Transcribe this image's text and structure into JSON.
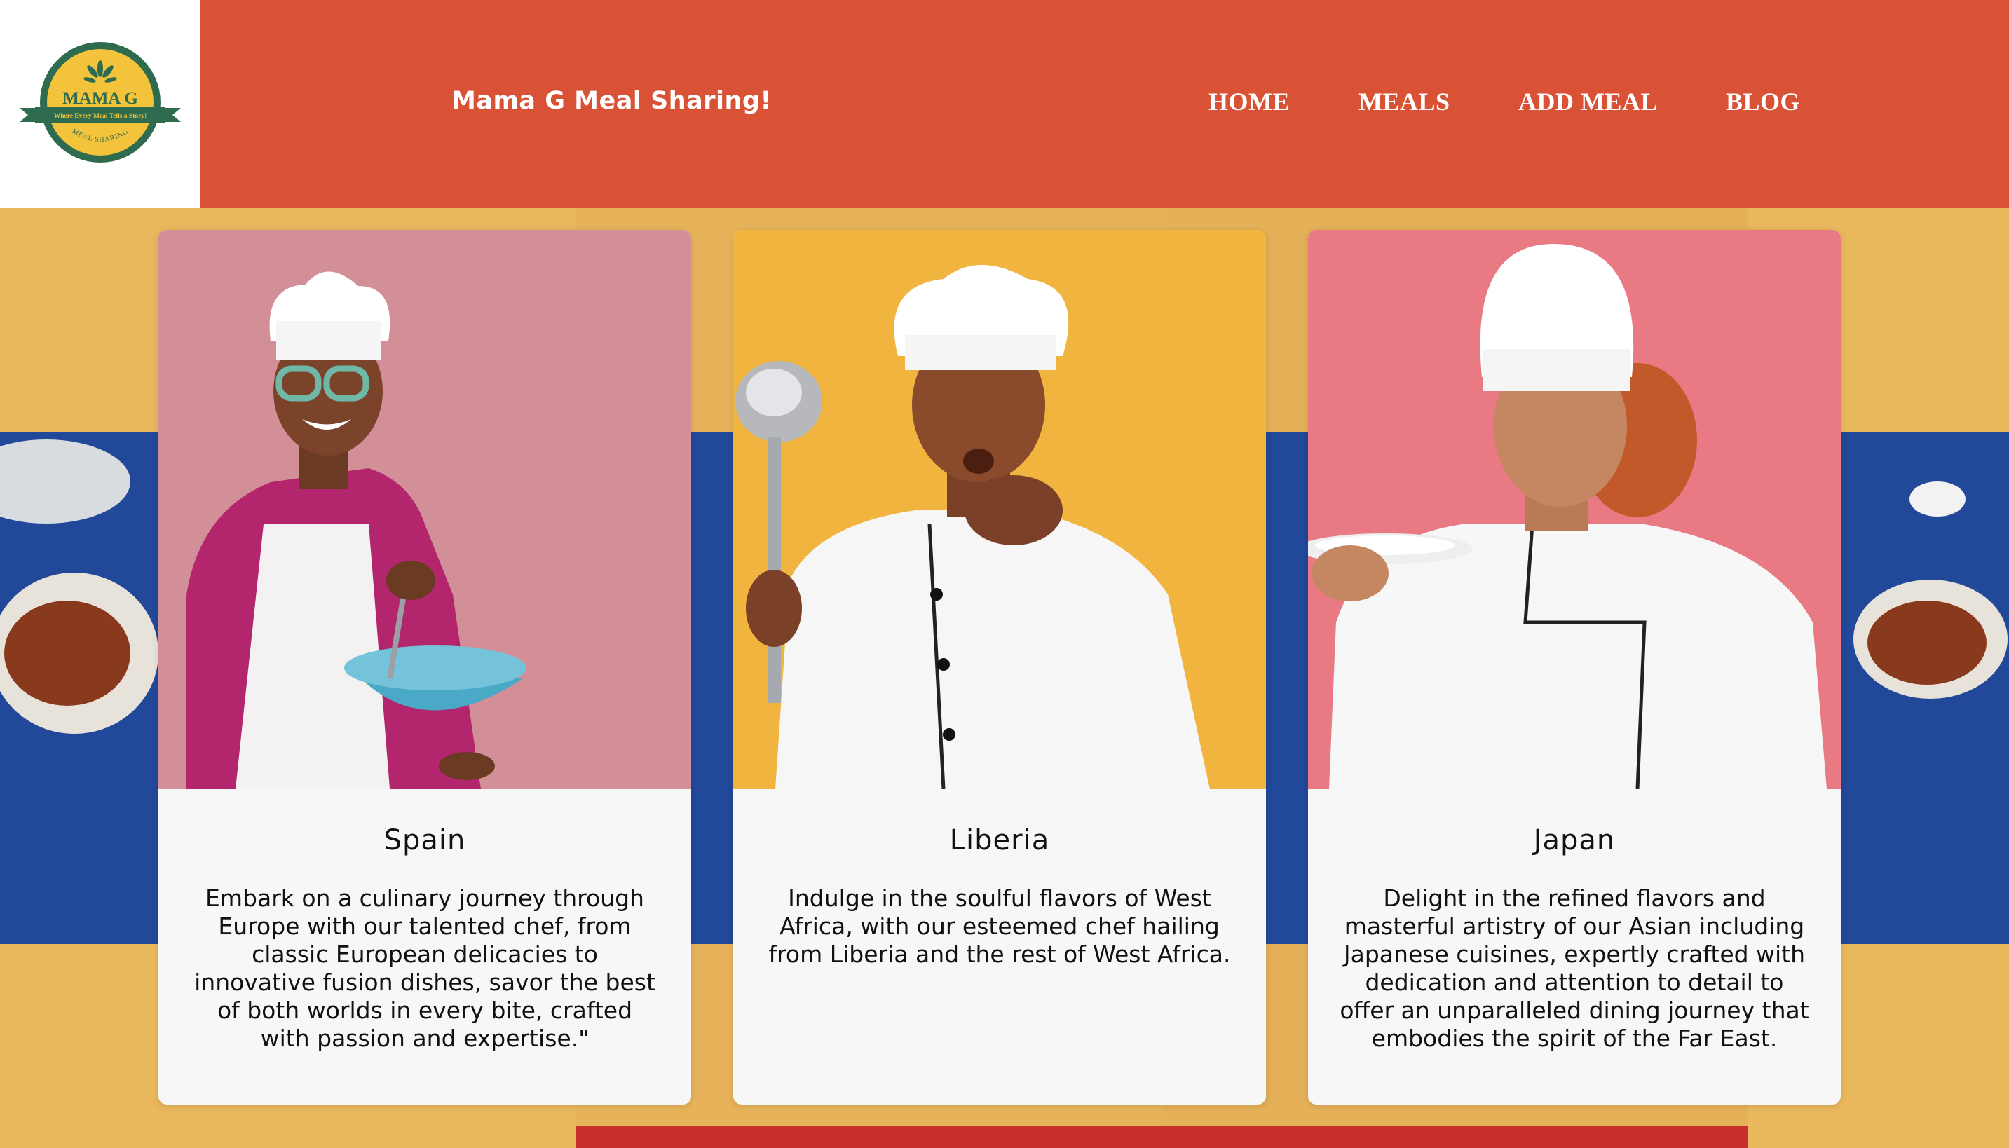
{
  "header": {
    "logo_title": "MAMA G",
    "logo_tagline": "Where Every Meal Tells a Story!",
    "logo_subtitle": "MEAL SHARING",
    "site_title": "Mama G Meal Sharing!",
    "nav": [
      {
        "label": "HOME"
      },
      {
        "label": "MEALS"
      },
      {
        "label": "ADD MEAL"
      },
      {
        "label": "BLOG"
      }
    ]
  },
  "cards": [
    {
      "title": "Spain",
      "description": "Embark on a culinary journey through Europe with our talented chef, from classic European delicacies to innovative fusion dishes, savor the best of both worlds in every bite, crafted with passion and expertise.\""
    },
    {
      "title": "Liberia",
      "description": "Indulge in the soulful flavors of West Africa, with our esteemed chef hailing from Liberia and the rest of West Africa."
    },
    {
      "title": "Japan",
      "description": "Delight in the refined flavors and masterful artistry of our Asian including Japanese cuisines, expertly crafted with dedication and attention to detail to offer an unparalleled dining journey that embodies the spirit of the Far East."
    }
  ],
  "colors": {
    "header_bg": "#d95235",
    "logo_green": "#2e6b4f",
    "logo_yellow": "#f2c33b",
    "card_bg": "#f7f7f7",
    "page_bg": "#e8b55a",
    "tablecloth_blue": "#22489a"
  }
}
